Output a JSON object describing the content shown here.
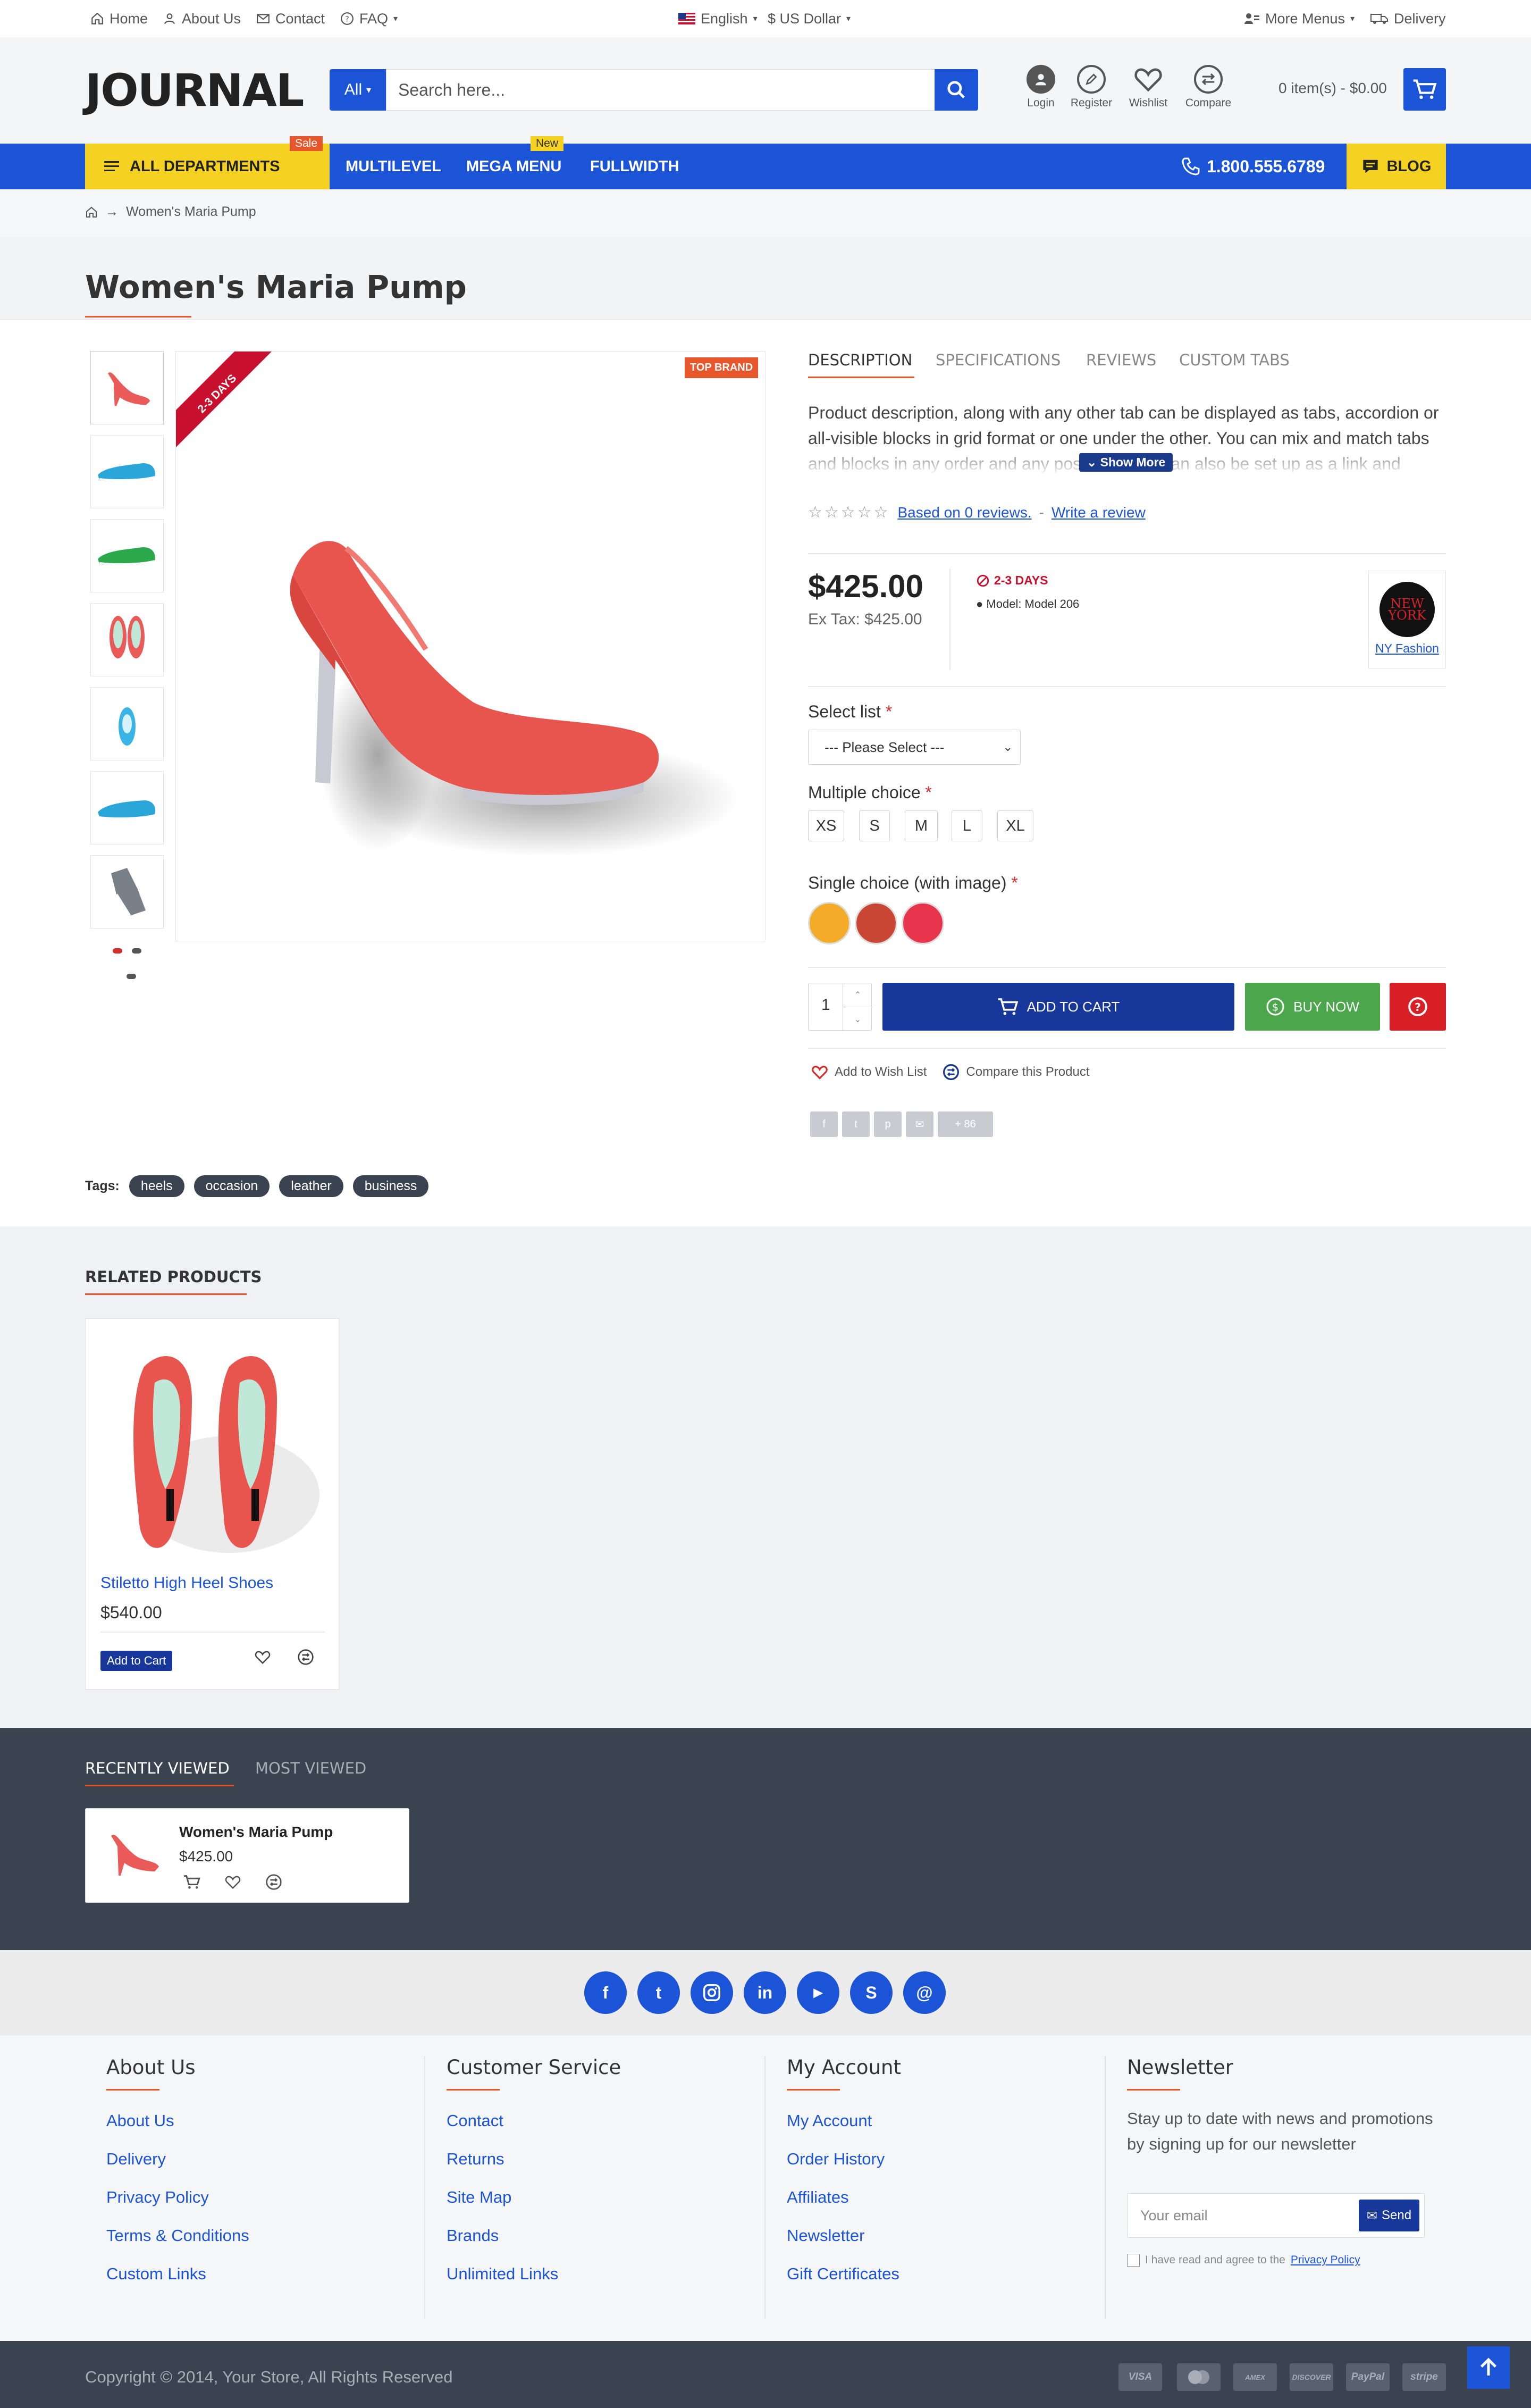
{
  "topbar": {
    "home": "Home",
    "about": "About Us",
    "contact": "Contact",
    "faq": "FAQ",
    "language": "English",
    "currency": "$ US Dollar",
    "more_menus": "More Menus",
    "delivery": "Delivery"
  },
  "header": {
    "logo": "JOURNAL",
    "search_category": "All",
    "search_placeholder": "Search here...",
    "icons": [
      {
        "label": "Login",
        "icon": "user-icon"
      },
      {
        "label": "Register",
        "icon": "pencil-icon"
      },
      {
        "label": "Wishlist",
        "icon": "heart-icon"
      },
      {
        "label": "Compare",
        "icon": "compare-icon"
      }
    ],
    "cart_text": "0 item(s) - $0.00"
  },
  "nav": {
    "all_departments": "ALL DEPARTMENTS",
    "sale_badge": "Sale",
    "multilevel": "MULTILEVEL",
    "mega_menu": "MEGA MENU",
    "new_badge": "New",
    "fullwidth": "FULLWIDTH",
    "phone": "1.800.555.6789",
    "blog": "BLOG",
    "accent": "#1b54d6",
    "yellow": "#f5d221"
  },
  "breadcrumb": {
    "current": "Women's Maria Pump"
  },
  "product": {
    "title": "Women's Maria Pump",
    "ribbon": "2-3 DAYS",
    "top_brand": "TOP BRAND",
    "tabs": [
      "DESCRIPTION",
      "SPECIFICATIONS",
      "REVIEWS",
      "CUSTOM TABS"
    ],
    "description": "Product description, along with any other tab can be displayed as tabs, accordion or all-visible blocks in grid format or one under the other.  You can mix and match tabs and blocks in any order and any position. Tabs can also be set up as a link and",
    "show_more": "Show More",
    "reviews_link": "Based on 0 reviews.",
    "write_review": "Write a review",
    "rating": 0,
    "price": "$425.00",
    "ex_tax": "Ex Tax: $425.00",
    "stock": "2-3 DAYS",
    "model": "Model: Model 206",
    "brand_name": "NY Fashion",
    "brand_logo_line1": "NEW",
    "brand_logo_line2": "YORK",
    "select_label": "Select list",
    "select_value": " --- Please Select --- ",
    "multiple_label": "Multiple choice",
    "sizes": [
      "XS",
      "S",
      "M",
      "L",
      "XL"
    ],
    "single_label": "Single choice (with image)",
    "swatches": [
      "#f4ab2a",
      "#c94634",
      "#e8344c"
    ],
    "qty": "1",
    "add_to_cart": "ADD TO CART",
    "buy_now": "BUY NOW",
    "wishlist": "Add to Wish List",
    "compare": "Compare this Product",
    "share_count": "86",
    "tags_label": "Tags:",
    "tags": [
      "heels",
      "occasion",
      "leather",
      "business"
    ]
  },
  "related": {
    "title": "RELATED PRODUCTS",
    "items": [
      {
        "name": "Stiletto High Heel Shoes",
        "price": "$540.00",
        "button": "Add to Cart"
      }
    ]
  },
  "recent": {
    "tab_active": "RECENTLY VIEWED",
    "tab_other": "MOST VIEWED",
    "items": [
      {
        "name": "Women's Maria Pump",
        "price": "$425.00"
      }
    ]
  },
  "footer": {
    "columns": [
      {
        "title": "About Us",
        "links": [
          "About Us",
          "Delivery",
          "Privacy Policy",
          "Terms & Conditions",
          "Custom Links"
        ]
      },
      {
        "title": "Customer Service",
        "links": [
          "Contact",
          "Returns",
          "Site Map",
          "Brands",
          "Unlimited Links"
        ]
      },
      {
        "title": "My Account",
        "links": [
          "My Account",
          "Order History",
          "Affiliates",
          "Newsletter",
          "Gift Certificates"
        ]
      }
    ],
    "newsletter": {
      "title": "Newsletter",
      "text": "Stay up to date with news and promotions by signing up for our newsletter",
      "placeholder": "Your email",
      "send": "Send",
      "agree": "I have read and agree to the",
      "privacy": "Privacy Policy"
    },
    "copyright": "Copyright © 2014, Your Store, All Rights Reserved",
    "payments": [
      "VISA",
      "MC",
      "AMEX",
      "DISCOVER",
      "PayPal",
      "stripe"
    ],
    "social": [
      "facebook-icon",
      "twitter-icon",
      "instagram-icon",
      "linkedin-icon",
      "youtube-icon",
      "skype-icon",
      "at-icon"
    ]
  }
}
